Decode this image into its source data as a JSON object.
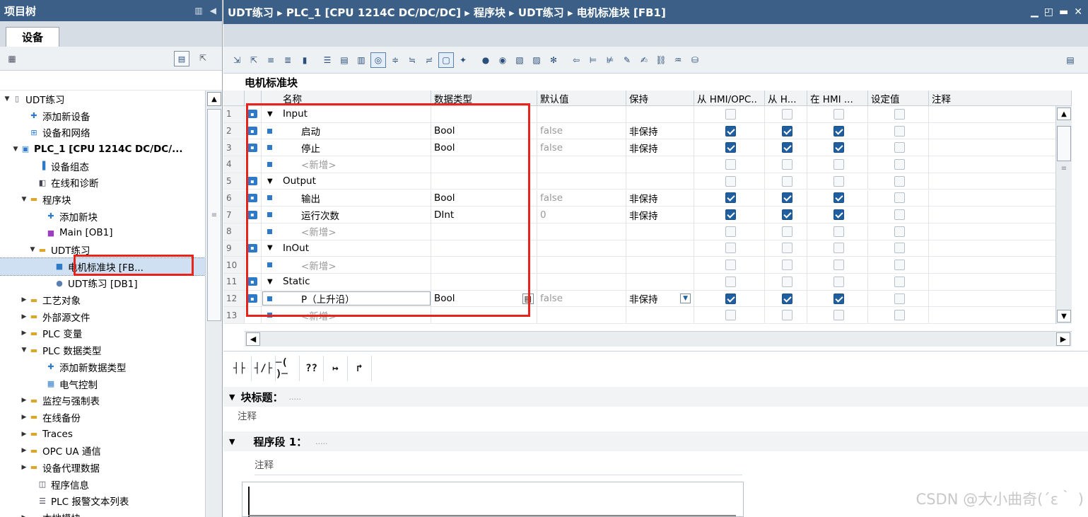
{
  "left_pane": {
    "title": "项目树",
    "tab": "设备",
    "tree": [
      {
        "label": "UDT练习",
        "arrow": "▼",
        "indent": 0,
        "icon": "page"
      },
      {
        "label": "添加新设备",
        "arrow": "",
        "indent": 2,
        "icon": "add-device"
      },
      {
        "label": "设备和网络",
        "arrow": "",
        "indent": 2,
        "icon": "network"
      },
      {
        "label": "PLC_1 [CPU 1214C DC/DC/...",
        "arrow": "▼",
        "indent": 1,
        "icon": "plc",
        "bold": true
      },
      {
        "label": "设备组态",
        "arrow": "",
        "indent": 3,
        "icon": "config"
      },
      {
        "label": "在线和诊断",
        "arrow": "",
        "indent": 3,
        "icon": "diag"
      },
      {
        "label": "程序块",
        "arrow": "▼",
        "indent": 2,
        "icon": "folder"
      },
      {
        "label": "添加新块",
        "arrow": "",
        "indent": 4,
        "icon": "add-block"
      },
      {
        "label": "Main [OB1]",
        "arrow": "",
        "indent": 4,
        "icon": "ob"
      },
      {
        "label": "UDT练习",
        "arrow": "▼",
        "indent": 3,
        "icon": "folder"
      },
      {
        "label": "电机标准块 [FB...",
        "arrow": "",
        "indent": 5,
        "icon": "fb",
        "selected": true
      },
      {
        "label": "UDT练习 [DB1]",
        "arrow": "",
        "indent": 5,
        "icon": "db"
      },
      {
        "label": "工艺对象",
        "arrow": "▶",
        "indent": 2,
        "icon": "folder"
      },
      {
        "label": "外部源文件",
        "arrow": "▶",
        "indent": 2,
        "icon": "folder"
      },
      {
        "label": "PLC 变量",
        "arrow": "▶",
        "indent": 2,
        "icon": "folder"
      },
      {
        "label": "PLC 数据类型",
        "arrow": "▼",
        "indent": 2,
        "icon": "folder"
      },
      {
        "label": "添加新数据类型",
        "arrow": "",
        "indent": 4,
        "icon": "add-block"
      },
      {
        "label": "电气控制",
        "arrow": "",
        "indent": 4,
        "icon": "udt"
      },
      {
        "label": "监控与强制表",
        "arrow": "▶",
        "indent": 2,
        "icon": "folder"
      },
      {
        "label": "在线备份",
        "arrow": "▶",
        "indent": 2,
        "icon": "folder"
      },
      {
        "label": "Traces",
        "arrow": "▶",
        "indent": 2,
        "icon": "folder"
      },
      {
        "label": "OPC UA 通信",
        "arrow": "▶",
        "indent": 2,
        "icon": "folder"
      },
      {
        "label": "设备代理数据",
        "arrow": "▶",
        "indent": 2,
        "icon": "folder"
      },
      {
        "label": "程序信息",
        "arrow": "",
        "indent": 3,
        "icon": "info"
      },
      {
        "label": "PLC 报警文本列表",
        "arrow": "",
        "indent": 3,
        "icon": "list"
      },
      {
        "label": "本地模块",
        "arrow": "▶",
        "indent": 2,
        "icon": "folder"
      }
    ]
  },
  "right_pane": {
    "breadcrumb": "UDT练习 ▸ PLC_1 [CPU 1214C DC/DC/DC] ▸ 程序块 ▸ UDT练习 ▸ 电机标准块 [FB1]",
    "block_name": "电机标准块",
    "columns": [
      "名称",
      "数据类型",
      "默认值",
      "保持",
      "从 HMI/OPC..",
      "从 H...",
      "在 HMI ...",
      "设定值",
      "注释"
    ],
    "rows": [
      {
        "num": "1",
        "section": true,
        "name": "Input",
        "type": "",
        "default": "",
        "retain": "",
        "hmi1": false,
        "hmi2": false,
        "hmi3": false,
        "set": false
      },
      {
        "num": "2",
        "name": "启动",
        "type": "Bool",
        "default": "false",
        "retain": "非保持",
        "hmi1": true,
        "hmi2": true,
        "hmi3": true,
        "set": false
      },
      {
        "num": "3",
        "name": "停止",
        "type": "Bool",
        "default": "false",
        "retain": "非保持",
        "hmi1": true,
        "hmi2": true,
        "hmi3": true,
        "set": false
      },
      {
        "num": "4",
        "name": "<新增>",
        "placeholder": true,
        "type": "",
        "default": "",
        "retain": "",
        "hmi1": false,
        "hmi2": false,
        "hmi3": false,
        "set": false
      },
      {
        "num": "5",
        "section": true,
        "name": "Output",
        "type": "",
        "default": "",
        "retain": "",
        "hmi1": false,
        "hmi2": false,
        "hmi3": false,
        "set": false
      },
      {
        "num": "6",
        "name": "输出",
        "type": "Bool",
        "default": "false",
        "retain": "非保持",
        "hmi1": true,
        "hmi2": true,
        "hmi3": true,
        "set": false
      },
      {
        "num": "7",
        "name": "运行次数",
        "type": "DInt",
        "default": "0",
        "retain": "非保持",
        "hmi1": true,
        "hmi2": true,
        "hmi3": true,
        "set": false
      },
      {
        "num": "8",
        "name": "<新增>",
        "placeholder": true,
        "type": "",
        "default": "",
        "retain": "",
        "hmi1": false,
        "hmi2": false,
        "hmi3": false,
        "set": false
      },
      {
        "num": "9",
        "section": true,
        "name": "InOut",
        "type": "",
        "default": "",
        "retain": "",
        "hmi1": false,
        "hmi2": false,
        "hmi3": false,
        "set": false
      },
      {
        "num": "10",
        "name": "<新增>",
        "placeholder": true,
        "type": "",
        "default": "",
        "retain": "",
        "hmi1": false,
        "hmi2": false,
        "hmi3": false,
        "set": false
      },
      {
        "num": "11",
        "section": true,
        "name": "Static",
        "type": "",
        "default": "",
        "retain": "",
        "hmi1": false,
        "hmi2": false,
        "hmi3": false,
        "set": false
      },
      {
        "num": "12",
        "name": "P（上升沿）",
        "type": "Bool",
        "default": "false",
        "retain": "非保持",
        "hmi1": true,
        "hmi2": true,
        "hmi3": true,
        "set": false,
        "editing": true
      },
      {
        "num": "13",
        "name": "<新增>",
        "placeholder": true,
        "type": "",
        "default": "",
        "retain": "",
        "hmi1": false,
        "hmi2": false,
        "hmi3": false,
        "set": false
      }
    ],
    "ladder_tools": [
      "┤├",
      "┤/├",
      "─( )─",
      "??",
      "↦",
      "↱"
    ],
    "block_title_label": "块标题：",
    "block_title_value": ".....",
    "block_comment": "注释",
    "network_label": "程序段 1：",
    "network_value": ".....",
    "network_comment": "注释"
  },
  "watermark": "CSDN @大小曲奇(´ε｀ )",
  "colors": {
    "titlebar": "#3b5f86",
    "highlight": "#e8231c",
    "checkbox": "#1f5fa0"
  }
}
